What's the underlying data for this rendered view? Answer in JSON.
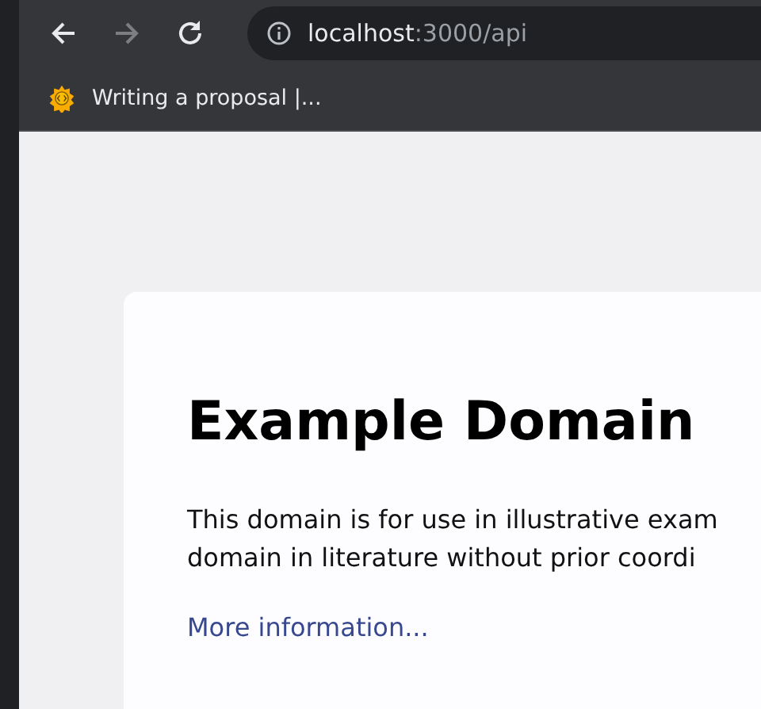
{
  "toolbar": {
    "back_enabled": true,
    "forward_enabled": false,
    "address": {
      "host": "localhost",
      "rest": ":3000/api"
    }
  },
  "bookmarks": [
    {
      "label": "Writing a proposal |..."
    }
  ],
  "page": {
    "heading": "Example Domain",
    "paragraph_lines": [
      "This domain is for use in illustrative exam",
      "domain in literature without prior coordi"
    ],
    "link": "More information..."
  }
}
